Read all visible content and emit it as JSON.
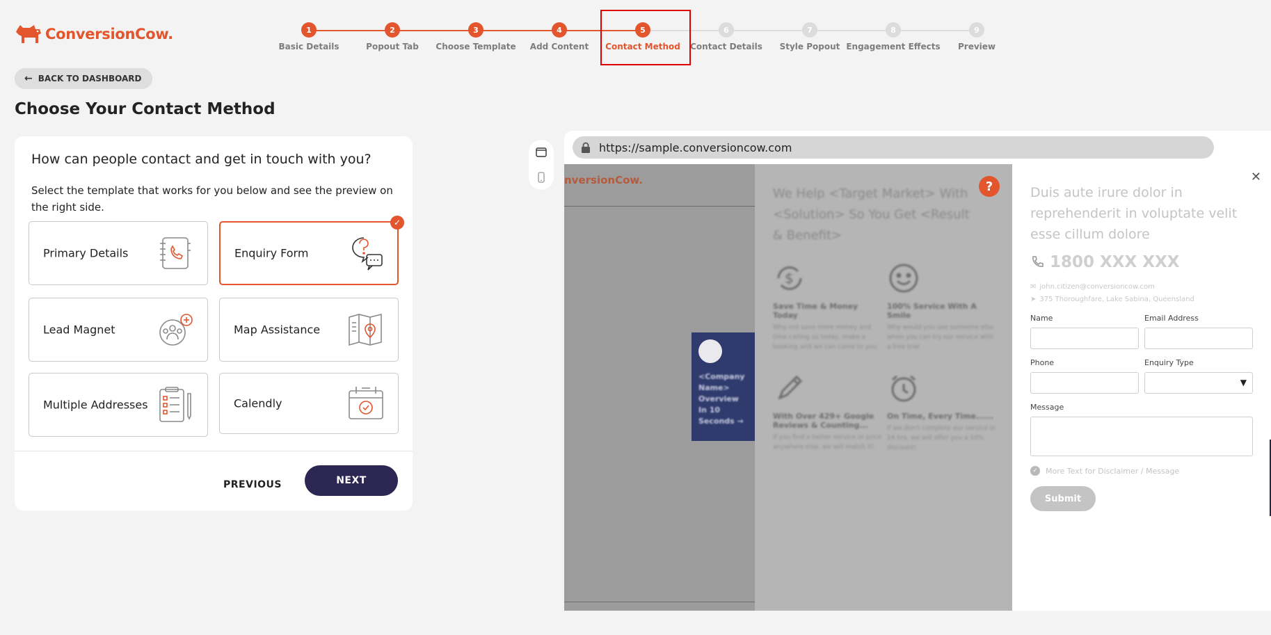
{
  "brand": {
    "name": "ConversionCow.",
    "color": "#e2552d"
  },
  "steps": [
    {
      "num": "1",
      "label": "Basic Details",
      "state": "done"
    },
    {
      "num": "2",
      "label": "Popout Tab",
      "state": "done"
    },
    {
      "num": "3",
      "label": "Choose Template",
      "state": "done"
    },
    {
      "num": "4",
      "label": "Add Content",
      "state": "done"
    },
    {
      "num": "5",
      "label": "Contact Method",
      "state": "active"
    },
    {
      "num": "6",
      "label": "Contact Details",
      "state": "todo"
    },
    {
      "num": "7",
      "label": "Style Popout",
      "state": "todo"
    },
    {
      "num": "8",
      "label": "Engagement Effects",
      "state": "todo"
    },
    {
      "num": "9",
      "label": "Preview",
      "state": "todo"
    }
  ],
  "back_label": "BACK TO DASHBOARD",
  "page_title": "Choose Your Contact Method",
  "panel": {
    "question": "How can people contact and get in touch with you?",
    "description": "Select the template that works for you below and see the preview on the right side.",
    "options": [
      {
        "label": "Primary Details",
        "icon": "address-book-phone-icon",
        "selected": false
      },
      {
        "label": "Enquiry Form",
        "icon": "question-chat-icon",
        "selected": true
      },
      {
        "label": "Lead Magnet",
        "icon": "group-add-icon",
        "selected": false
      },
      {
        "label": "Map Assistance",
        "icon": "map-pin-icon",
        "selected": false
      },
      {
        "label": "Multiple Addresses",
        "icon": "checklist-icon",
        "selected": false
      },
      {
        "label": "Calendly",
        "icon": "calendar-check-icon",
        "selected": false
      }
    ],
    "previous_label": "PREVIOUS",
    "next_label": "NEXT"
  },
  "preview": {
    "url": "https://sample.conversioncow.com",
    "site_brand": "nversionCow.",
    "side_tab_text": "<Company Name> Overview In 10 Seconds →",
    "headline": "We Help <Target Market> With <Solution> So You Get <Result & Benefit>",
    "features": [
      {
        "title": "Save Time & Money Today",
        "text": "Why not save more money and time calling us today, make a booking and we can come to you",
        "icon": "dollar-refresh-icon"
      },
      {
        "title": "100% Service With A Smile",
        "text": "Why would you use someone else when you can try our service with a free trial",
        "icon": "smile-icon"
      },
      {
        "title": "With Over 429+ Google Reviews & Counting...",
        "text": "If you find a better service or price anywhere else, we will match it!",
        "icon": "pencil-icon"
      },
      {
        "title": "On Time, Every Time......",
        "text": "If we don't complete our service in 24 hrs, we will offer you a 10% discount!",
        "icon": "alarm-clock-icon"
      }
    ],
    "help_badge": "?",
    "form": {
      "heading": "Duis aute irure dolor in reprehenderit in voluptate velit esse cillum dolore",
      "phone": "1800 XXX XXX",
      "email": "john.citizen@conversioncow.com",
      "address": "375 Thoroughfare, Lake Sabina, Queensland",
      "name_label": "Name",
      "email_label": "Email Address",
      "phone_label": "Phone",
      "enquiry_label": "Enquiry Type",
      "message_label": "Message",
      "disclaimer": "More Text for Disclaimer / Message",
      "submit": "Submit"
    }
  }
}
